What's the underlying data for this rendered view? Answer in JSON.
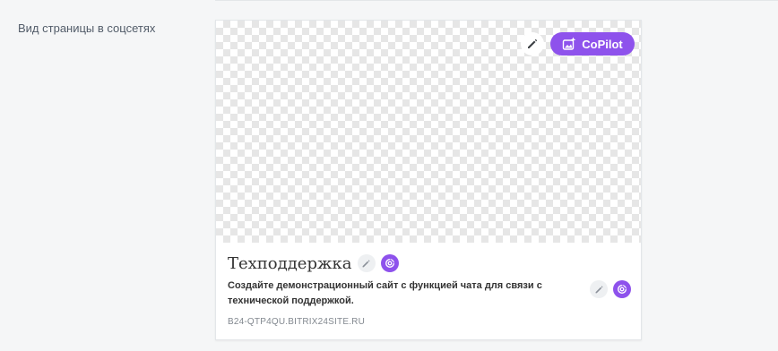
{
  "section": {
    "label": "Вид страницы в соцсетях"
  },
  "card": {
    "copilot_label": "CoPilot",
    "title": "Техподдержка",
    "description": "Создайте демонстрационный сайт с функцией чата для связи с технической поддержкой.",
    "url": "B24-QTP4QU.BITRIX24SITE.RU"
  },
  "icons": {
    "image_edit": "pencil-icon",
    "copilot": "image-sparkle-icon",
    "title_edit": "pencil-icon",
    "title_ai": "copilot-swirl-icon",
    "desc_edit": "pencil-icon",
    "desc_ai": "copilot-swirl-icon"
  },
  "colors": {
    "accent": "#8e52ec",
    "background": "#f5f6f7",
    "text": "#333333",
    "muted": "#82888f"
  }
}
